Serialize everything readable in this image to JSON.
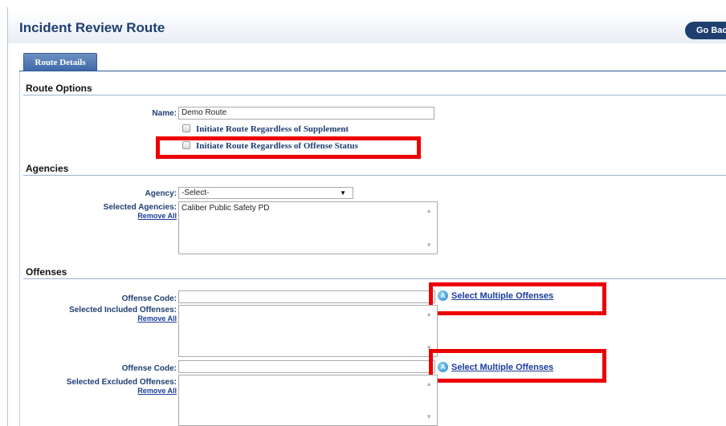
{
  "page": {
    "title": "Incident Review Route",
    "go_back_label": "Go Back"
  },
  "tabs": [
    {
      "label": "Route Details",
      "active": true
    }
  ],
  "route_options": {
    "section_title": "Route Options",
    "name_label": "Name:",
    "name_value": "Demo Route",
    "checkbox_supplement": {
      "label": "Initiate Route Regardless of Supplement",
      "checked": false
    },
    "checkbox_offense_status": {
      "label": "Initiate Route Regardless of Offense Status",
      "checked": false
    }
  },
  "agencies": {
    "section_title": "Agencies",
    "agency_label": "Agency:",
    "agency_selected": "-Select-",
    "selected_label": "Selected Agencies:",
    "remove_all": "Remove All",
    "selected_items": [
      "Caliber Public Safety PD"
    ]
  },
  "offenses": {
    "section_title": "Offenses",
    "included": {
      "code_label": "Offense Code:",
      "code_value": "",
      "multi_link": "Select Multiple Offenses",
      "selected_label": "Selected Included Offenses:",
      "remove_all": "Remove All"
    },
    "excluded": {
      "code_label": "Offense Code:",
      "code_value": "",
      "multi_link": "Select Multiple Offenses",
      "selected_label": "Selected Excluded Offenses:",
      "remove_all": "Remove All"
    }
  },
  "colors": {
    "title": "#1f3f72",
    "tab": "#3f69a8",
    "highlight": "#ee0000",
    "link": "#1a3d9b"
  }
}
